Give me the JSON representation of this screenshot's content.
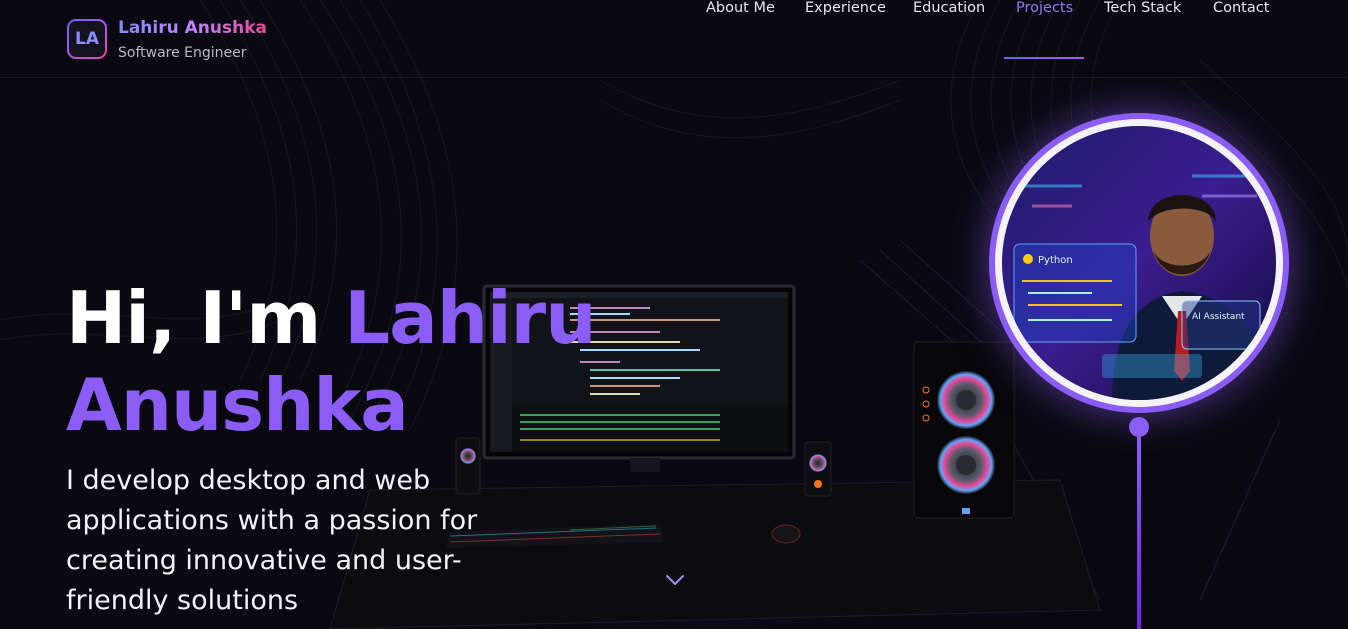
{
  "brand": {
    "initials": "LA",
    "name": "Lahiru Anushka",
    "subtitle": "Software Engineer"
  },
  "nav": {
    "items": [
      {
        "label": "About Me",
        "active": false
      },
      {
        "label": "Experience",
        "active": false
      },
      {
        "label": "Education",
        "active": false
      },
      {
        "label": "Projects",
        "active": true
      },
      {
        "label": "Tech Stack",
        "active": false
      },
      {
        "label": "Contact",
        "active": false
      }
    ]
  },
  "hero": {
    "greeting": "Hi, I'm ",
    "first_name": "Lahiru",
    "last_name": "Anushka",
    "tagline": "I develop desktop and web applications with a passion for creating innovative and user-friendly solutions"
  },
  "avatar": {
    "python_label": "Python",
    "assistant_label": "AI Assistant"
  },
  "icons": {
    "scroll": "chevron-down-icon"
  },
  "colors": {
    "background": "#0a0912",
    "accent": "#8b5cf6",
    "nav_active": "#8b7cf6",
    "brand_gradient_start": "#818cf8",
    "brand_gradient_end": "#ec4899"
  }
}
